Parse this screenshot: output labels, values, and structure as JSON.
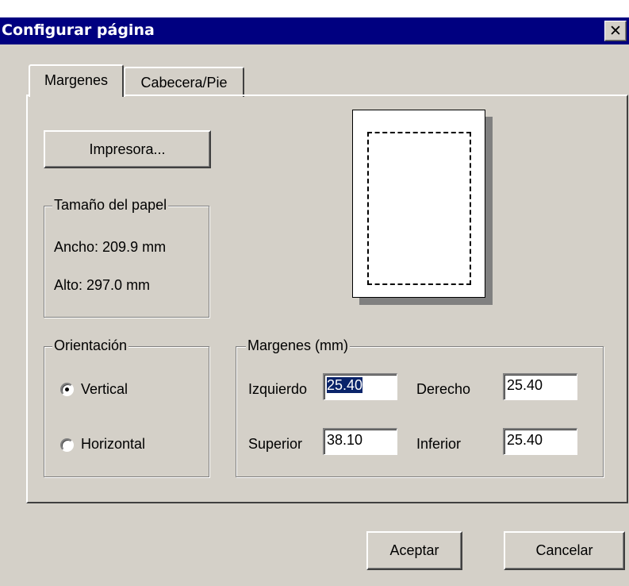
{
  "window": {
    "title": "Configurar página",
    "close_glyph": "✕"
  },
  "tabs": [
    {
      "label": "Margenes",
      "active": true
    },
    {
      "label": "Cabecera/Pie",
      "active": false
    }
  ],
  "printer_button": "Impresora...",
  "paper_size": {
    "legend": "Tamaño del papel",
    "width_text": "Ancho: 209.9 mm",
    "height_text": "Alto: 297.0 mm"
  },
  "orientation": {
    "legend": "Orientación",
    "options": [
      {
        "label": "Vertical",
        "checked": true
      },
      {
        "label": "Horizontal",
        "checked": false
      }
    ]
  },
  "margins": {
    "legend": "Margenes (mm)",
    "left_label": "Izquierdo",
    "left_value": "25.40",
    "right_label": "Derecho",
    "right_value": "25.40",
    "top_label": "Superior",
    "top_value": "38.10",
    "bottom_label": "Inferior",
    "bottom_value": "25.40"
  },
  "buttons": {
    "ok": "Aceptar",
    "cancel": "Cancelar"
  },
  "colors": {
    "title_bar": "#000080",
    "face": "#d4d0c8",
    "selection": "#0a246a"
  }
}
